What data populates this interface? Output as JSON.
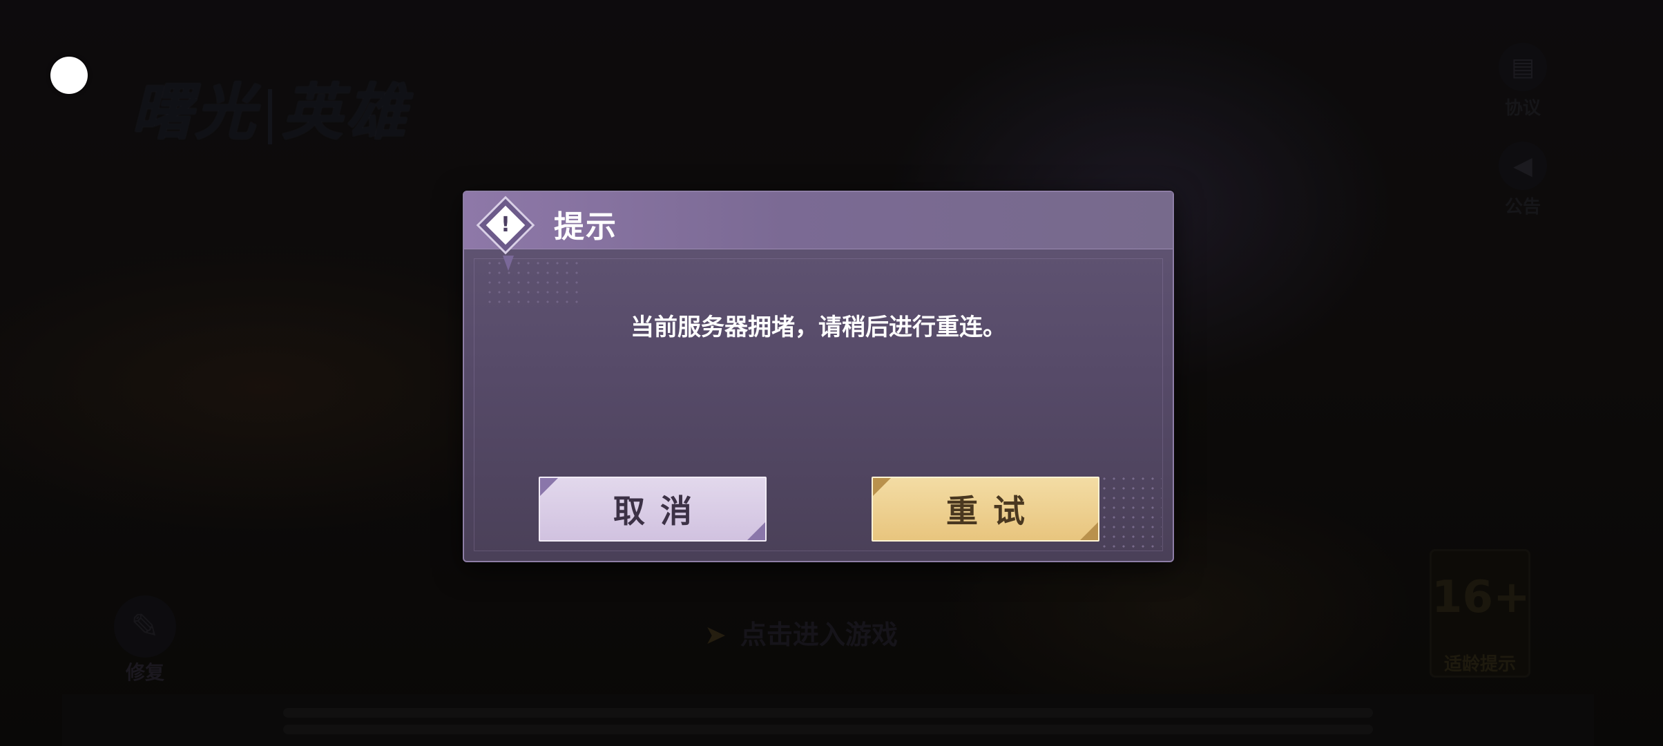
{
  "background": {
    "logo_title_left": "曙光",
    "logo_title_right": "英雄",
    "side_buttons": [
      {
        "label": "协议",
        "icon": "document-icon"
      },
      {
        "label": "公告",
        "icon": "megaphone-icon"
      }
    ],
    "repair_label": "修复",
    "enter_game_label": "点击进入游戏",
    "age_rating": {
      "number": "16+",
      "label": "适龄提示"
    }
  },
  "dialog": {
    "title": "提示",
    "icon": "alert-diamond-icon",
    "message": "当前服务器拥堵，请稍后进行重连。",
    "cancel_label": "取消",
    "retry_label": "重试"
  },
  "colors": {
    "dialog_bg": "#564a68",
    "header_bg": "#8e78a8",
    "cancel_bg": "#d9cce6",
    "retry_bg": "#efd290"
  }
}
